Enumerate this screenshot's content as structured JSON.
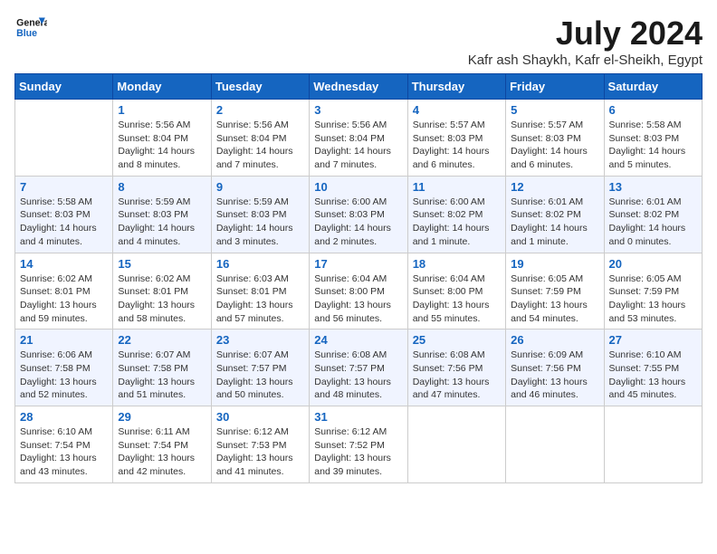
{
  "logo": {
    "line1": "General",
    "line2": "Blue"
  },
  "title": "July 2024",
  "location": "Kafr ash Shaykh, Kafr el-Sheikh, Egypt",
  "days_of_week": [
    "Sunday",
    "Monday",
    "Tuesday",
    "Wednesday",
    "Thursday",
    "Friday",
    "Saturday"
  ],
  "weeks": [
    [
      {
        "day": "",
        "sunrise": "",
        "sunset": "",
        "daylight": ""
      },
      {
        "day": "1",
        "sunrise": "Sunrise: 5:56 AM",
        "sunset": "Sunset: 8:04 PM",
        "daylight": "Daylight: 14 hours and 8 minutes."
      },
      {
        "day": "2",
        "sunrise": "Sunrise: 5:56 AM",
        "sunset": "Sunset: 8:04 PM",
        "daylight": "Daylight: 14 hours and 7 minutes."
      },
      {
        "day": "3",
        "sunrise": "Sunrise: 5:56 AM",
        "sunset": "Sunset: 8:04 PM",
        "daylight": "Daylight: 14 hours and 7 minutes."
      },
      {
        "day": "4",
        "sunrise": "Sunrise: 5:57 AM",
        "sunset": "Sunset: 8:03 PM",
        "daylight": "Daylight: 14 hours and 6 minutes."
      },
      {
        "day": "5",
        "sunrise": "Sunrise: 5:57 AM",
        "sunset": "Sunset: 8:03 PM",
        "daylight": "Daylight: 14 hours and 6 minutes."
      },
      {
        "day": "6",
        "sunrise": "Sunrise: 5:58 AM",
        "sunset": "Sunset: 8:03 PM",
        "daylight": "Daylight: 14 hours and 5 minutes."
      }
    ],
    [
      {
        "day": "7",
        "sunrise": "Sunrise: 5:58 AM",
        "sunset": "Sunset: 8:03 PM",
        "daylight": "Daylight: 14 hours and 4 minutes."
      },
      {
        "day": "8",
        "sunrise": "Sunrise: 5:59 AM",
        "sunset": "Sunset: 8:03 PM",
        "daylight": "Daylight: 14 hours and 4 minutes."
      },
      {
        "day": "9",
        "sunrise": "Sunrise: 5:59 AM",
        "sunset": "Sunset: 8:03 PM",
        "daylight": "Daylight: 14 hours and 3 minutes."
      },
      {
        "day": "10",
        "sunrise": "Sunrise: 6:00 AM",
        "sunset": "Sunset: 8:03 PM",
        "daylight": "Daylight: 14 hours and 2 minutes."
      },
      {
        "day": "11",
        "sunrise": "Sunrise: 6:00 AM",
        "sunset": "Sunset: 8:02 PM",
        "daylight": "Daylight: 14 hours and 1 minute."
      },
      {
        "day": "12",
        "sunrise": "Sunrise: 6:01 AM",
        "sunset": "Sunset: 8:02 PM",
        "daylight": "Daylight: 14 hours and 1 minute."
      },
      {
        "day": "13",
        "sunrise": "Sunrise: 6:01 AM",
        "sunset": "Sunset: 8:02 PM",
        "daylight": "Daylight: 14 hours and 0 minutes."
      }
    ],
    [
      {
        "day": "14",
        "sunrise": "Sunrise: 6:02 AM",
        "sunset": "Sunset: 8:01 PM",
        "daylight": "Daylight: 13 hours and 59 minutes."
      },
      {
        "day": "15",
        "sunrise": "Sunrise: 6:02 AM",
        "sunset": "Sunset: 8:01 PM",
        "daylight": "Daylight: 13 hours and 58 minutes."
      },
      {
        "day": "16",
        "sunrise": "Sunrise: 6:03 AM",
        "sunset": "Sunset: 8:01 PM",
        "daylight": "Daylight: 13 hours and 57 minutes."
      },
      {
        "day": "17",
        "sunrise": "Sunrise: 6:04 AM",
        "sunset": "Sunset: 8:00 PM",
        "daylight": "Daylight: 13 hours and 56 minutes."
      },
      {
        "day": "18",
        "sunrise": "Sunrise: 6:04 AM",
        "sunset": "Sunset: 8:00 PM",
        "daylight": "Daylight: 13 hours and 55 minutes."
      },
      {
        "day": "19",
        "sunrise": "Sunrise: 6:05 AM",
        "sunset": "Sunset: 7:59 PM",
        "daylight": "Daylight: 13 hours and 54 minutes."
      },
      {
        "day": "20",
        "sunrise": "Sunrise: 6:05 AM",
        "sunset": "Sunset: 7:59 PM",
        "daylight": "Daylight: 13 hours and 53 minutes."
      }
    ],
    [
      {
        "day": "21",
        "sunrise": "Sunrise: 6:06 AM",
        "sunset": "Sunset: 7:58 PM",
        "daylight": "Daylight: 13 hours and 52 minutes."
      },
      {
        "day": "22",
        "sunrise": "Sunrise: 6:07 AM",
        "sunset": "Sunset: 7:58 PM",
        "daylight": "Daylight: 13 hours and 51 minutes."
      },
      {
        "day": "23",
        "sunrise": "Sunrise: 6:07 AM",
        "sunset": "Sunset: 7:57 PM",
        "daylight": "Daylight: 13 hours and 50 minutes."
      },
      {
        "day": "24",
        "sunrise": "Sunrise: 6:08 AM",
        "sunset": "Sunset: 7:57 PM",
        "daylight": "Daylight: 13 hours and 48 minutes."
      },
      {
        "day": "25",
        "sunrise": "Sunrise: 6:08 AM",
        "sunset": "Sunset: 7:56 PM",
        "daylight": "Daylight: 13 hours and 47 minutes."
      },
      {
        "day": "26",
        "sunrise": "Sunrise: 6:09 AM",
        "sunset": "Sunset: 7:56 PM",
        "daylight": "Daylight: 13 hours and 46 minutes."
      },
      {
        "day": "27",
        "sunrise": "Sunrise: 6:10 AM",
        "sunset": "Sunset: 7:55 PM",
        "daylight": "Daylight: 13 hours and 45 minutes."
      }
    ],
    [
      {
        "day": "28",
        "sunrise": "Sunrise: 6:10 AM",
        "sunset": "Sunset: 7:54 PM",
        "daylight": "Daylight: 13 hours and 43 minutes."
      },
      {
        "day": "29",
        "sunrise": "Sunrise: 6:11 AM",
        "sunset": "Sunset: 7:54 PM",
        "daylight": "Daylight: 13 hours and 42 minutes."
      },
      {
        "day": "30",
        "sunrise": "Sunrise: 6:12 AM",
        "sunset": "Sunset: 7:53 PM",
        "daylight": "Daylight: 13 hours and 41 minutes."
      },
      {
        "day": "31",
        "sunrise": "Sunrise: 6:12 AM",
        "sunset": "Sunset: 7:52 PM",
        "daylight": "Daylight: 13 hours and 39 minutes."
      },
      {
        "day": "",
        "sunrise": "",
        "sunset": "",
        "daylight": ""
      },
      {
        "day": "",
        "sunrise": "",
        "sunset": "",
        "daylight": ""
      },
      {
        "day": "",
        "sunrise": "",
        "sunset": "",
        "daylight": ""
      }
    ]
  ]
}
